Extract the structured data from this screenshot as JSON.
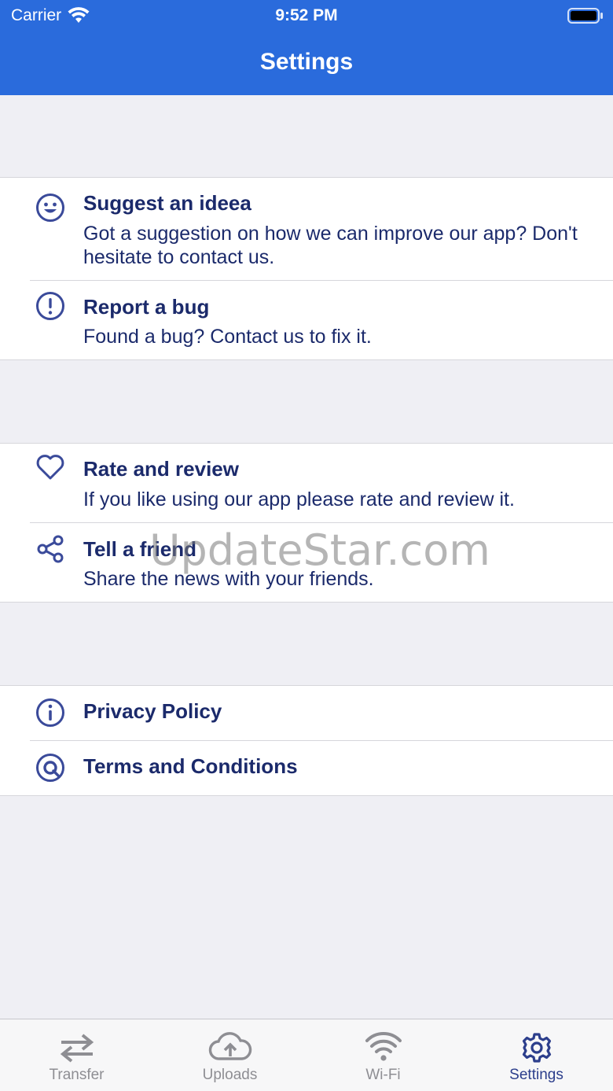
{
  "status_bar": {
    "carrier": "Carrier",
    "time": "9:52 PM"
  },
  "nav": {
    "title": "Settings"
  },
  "groups": [
    {
      "rows": [
        {
          "title": "Suggest an ideea",
          "subtitle": "Got a suggestion on how we can improve our app? Don't hesitate to contact us.",
          "icon": "smile-icon"
        },
        {
          "title": "Report a bug",
          "subtitle": "Found a bug? Contact us to fix it.",
          "icon": "alert-circle-icon"
        }
      ]
    },
    {
      "rows": [
        {
          "title": "Rate and review",
          "subtitle": "If you like using our app please rate and review it.",
          "icon": "heart-icon"
        },
        {
          "title": "Tell a friend",
          "subtitle": "Share the news with your friends.",
          "icon": "share-icon"
        }
      ]
    },
    {
      "rows": [
        {
          "title": "Privacy Policy",
          "icon": "info-icon"
        },
        {
          "title": "Terms and Conditions",
          "icon": "at-sign-icon"
        }
      ]
    }
  ],
  "watermark": "UpdateStar.com",
  "tabbar": {
    "tabs": [
      {
        "label": "Transfer",
        "icon": "transfer-icon",
        "active": false
      },
      {
        "label": "Uploads",
        "icon": "cloud-upload-icon",
        "active": false
      },
      {
        "label": "Wi-Fi",
        "icon": "wifi-icon",
        "active": false
      },
      {
        "label": "Settings",
        "icon": "gear-icon",
        "active": true
      }
    ]
  },
  "colors": {
    "nav_background": "#2a6bdc",
    "text_primary": "#1b2a6b",
    "tab_inactive": "#8e8e93",
    "tab_active": "#2c3e8c"
  }
}
